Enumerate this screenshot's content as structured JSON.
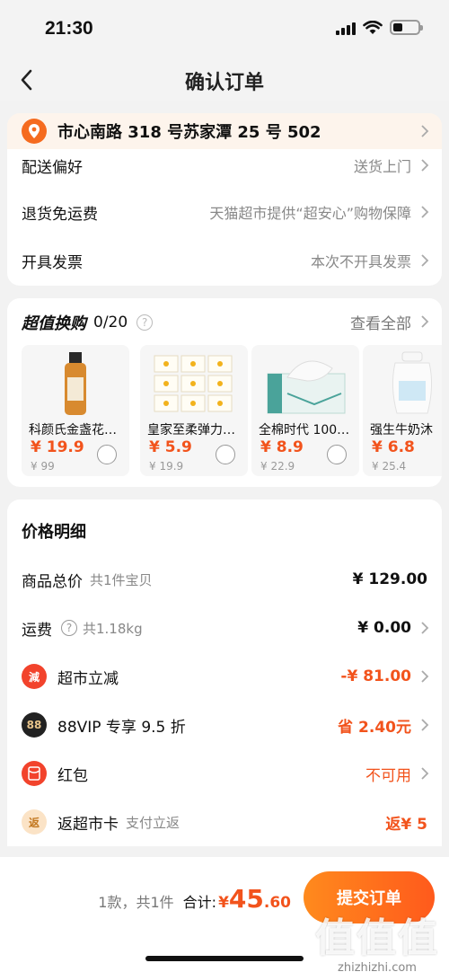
{
  "status": {
    "time": "21:30",
    "battery_level": 0.4
  },
  "nav": {
    "title": "确认订单"
  },
  "address": {
    "text": "市心南路 318 号苏家潭 25 号 502"
  },
  "info_rows": [
    {
      "label": "配送偏好",
      "value": "送货上门"
    },
    {
      "label": "退货免运费",
      "value": "天猫超市提供“超安心”购物保障"
    },
    {
      "label": "开具发票",
      "value": "本次不开具发票"
    }
  ],
  "deals": {
    "title": "超值换购",
    "count": "0/20",
    "view_all": "查看全部",
    "items": [
      {
        "name": "科颜氏金盏花…",
        "price": "¥ 19.9",
        "original": "¥ 99"
      },
      {
        "name": "皇家至柔弹力…",
        "price": "¥ 5.9",
        "original": "¥ 19.9"
      },
      {
        "name": "全棉时代 100…",
        "price": "¥ 8.9",
        "original": "¥ 22.9"
      },
      {
        "name": "强生牛奶沐",
        "price": "¥ 6.8",
        "original": "¥ 25.4"
      }
    ]
  },
  "price": {
    "title": "价格明细",
    "goods_total": {
      "label": "商品总价",
      "sub": "共1件宝贝",
      "value": "¥ 129.00"
    },
    "shipping": {
      "label": "运费",
      "sub": "共1.18kg",
      "value": "¥ 0.00"
    },
    "discount": {
      "label": "超市立减",
      "value": "-¥ 81.00",
      "icon_text": "減"
    },
    "vip": {
      "label": "88VIP 专享 9.5 折",
      "value": "省 2.40元",
      "icon_text": "88"
    },
    "redpacket": {
      "label": "红包",
      "value": "不可用"
    },
    "card": {
      "label": "返超市卡",
      "sub": "支付立返",
      "value": "返¥ 5",
      "icon_text": "返"
    }
  },
  "bottom": {
    "count_text": "1款，共1件",
    "total_label": "合计:",
    "yen": "¥",
    "total_int": "45",
    "total_dec": ".60",
    "submit_label": "提交订单"
  },
  "watermark": {
    "glyphs": "值值值",
    "url": "zhizhizhi.com"
  },
  "colors": {
    "accent": "#f2531c",
    "address_bg": "#fdf4ec",
    "location_icon": "#f56b1f"
  }
}
